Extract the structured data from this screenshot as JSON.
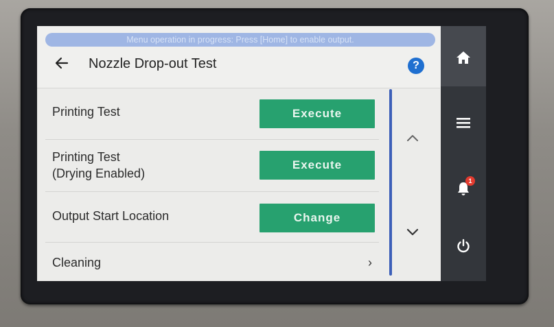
{
  "banner": {
    "text": "Menu operation in progress: Press [Home] to enable output."
  },
  "header": {
    "title": "Nozzle Drop-out Test",
    "help_label": "?"
  },
  "rows": [
    {
      "label_line1": "Printing Test",
      "label_line2": "",
      "button": "Execute"
    },
    {
      "label_line1": "Printing Test",
      "label_line2": "(Drying Enabled)",
      "button": "Execute"
    },
    {
      "label_line1": "Output Start Location",
      "label_line2": "",
      "button": "Change"
    },
    {
      "label_line1": "Cleaning",
      "label_line2": "",
      "chevron": "›"
    }
  ],
  "sidebar": {
    "notification_count": "1"
  },
  "colors": {
    "accent_button": "#27a16f",
    "banner": "#9fb6e4",
    "help": "#1f6fd0",
    "sidebar": "#33363b"
  }
}
